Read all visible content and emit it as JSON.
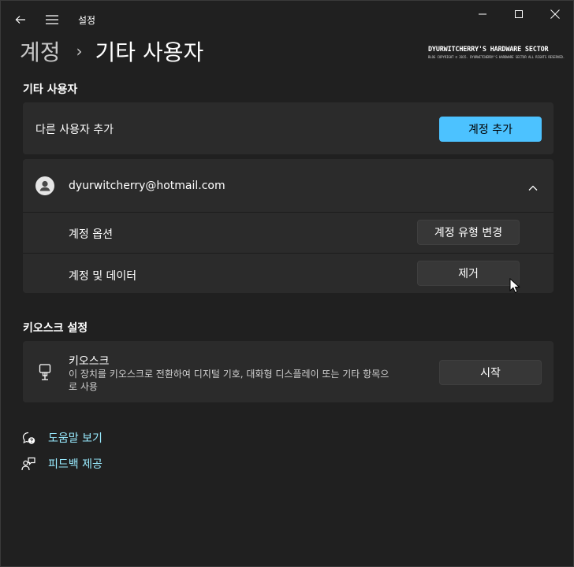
{
  "titlebar": {
    "title": "설정",
    "icons": [
      "back-arrow-icon",
      "hamburger-menu-icon"
    ],
    "window_controls": [
      "minimize-icon",
      "maximize-icon",
      "close-icon"
    ]
  },
  "breadcrumb": {
    "parent": "계정",
    "separator": "›",
    "current": "기타 사용자"
  },
  "watermark": {
    "title": "DYURWITCHERRY'S HARDWARE SECTOR",
    "subtitle": "BLOG COPYRIGHT © 2015. DYURWITCHERRY'S HARDWARE SECTOR ALL RIGHTS RESERVED."
  },
  "other_users": {
    "section_title": "기타 사용자",
    "add_user": {
      "label": "다른 사용자 추가",
      "button_label": "계정 추가"
    },
    "user": {
      "email": "dyurwitcherry@hotmail.com",
      "icon": "user-avatar-icon",
      "expand_icon": "chevron-up-icon",
      "options": [
        {
          "label": "계정 옵션",
          "button_label": "계정 유형 변경"
        },
        {
          "label": "계정 및 데이터",
          "button_label": "제거"
        }
      ]
    }
  },
  "kiosk": {
    "section_title": "키오스크 설정",
    "title": "키오스크",
    "description_line1": "이 장치를 키오스크로 전환하여 디지털 기호, 대화형 디스플레이 또는 기타 항목으",
    "description_line2": "로 사용",
    "icon": "kiosk-icon",
    "button_label": "시작"
  },
  "links": [
    {
      "label": "도움말 보기",
      "icon": "help-chat-icon"
    },
    {
      "label": "피드백 제공",
      "icon": "feedback-icon"
    }
  ],
  "colors": {
    "background": "#202020",
    "card": "#2b2b2b",
    "accent": "#4cc2ff",
    "link": "#99ebff"
  }
}
